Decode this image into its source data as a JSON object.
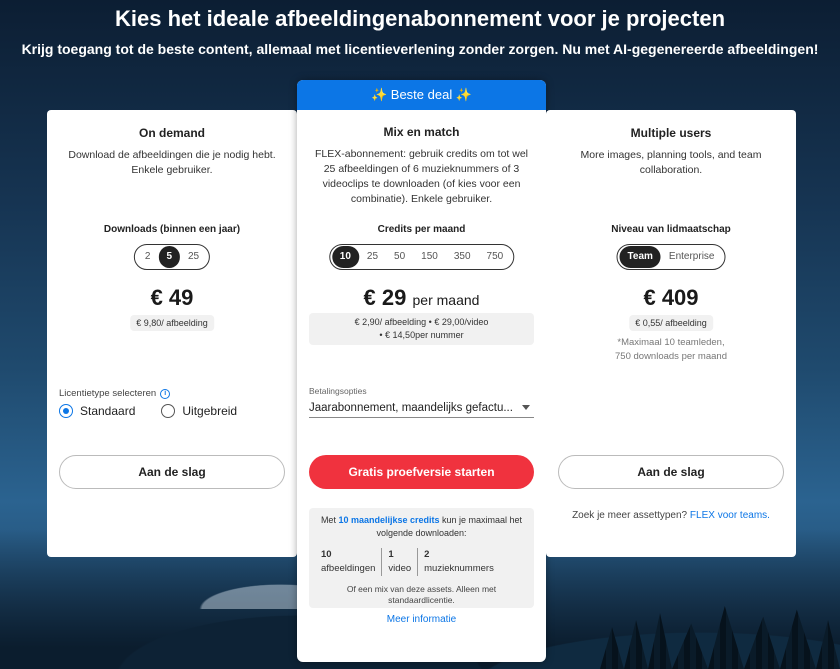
{
  "header": {
    "title": "Kies het ideale afbeeldingenabonnement voor je projecten",
    "subtitle": "Krijg toegang tot de beste content, allemaal met licentieverlening zonder zorgen. Nu met AI-gegenereerde afbeeldingen!"
  },
  "colors": {
    "accent": "#0c76e6",
    "cta": "#f0323e"
  },
  "on_demand": {
    "title": "On demand",
    "description": "Download de afbeeldingen die je nodig hebt. Enkele gebruiker.",
    "selector_label": "Downloads (binnen een jaar)",
    "options": [
      "2",
      "5",
      "25"
    ],
    "selected": "5",
    "price": "€ 49",
    "price_per_item": "€ 9,80/ afbeelding",
    "license_label": "Licentietype selecteren",
    "license_options": [
      "Standaard",
      "Uitgebreid"
    ],
    "license_selected": "Standaard",
    "cta": "Aan de slag"
  },
  "mix_match": {
    "banner": "✨ Beste deal ✨",
    "title": "Mix en match",
    "description": "FLEX-abonnement: gebruik credits om tot wel 25 afbeeldingen of 6 muzieknummers of 3 videoclips te downloaden (of kies voor een combinatie). Enkele gebruiker.",
    "selector_label": "Credits per maand",
    "options": [
      "10",
      "25",
      "50",
      "150",
      "350",
      "750"
    ],
    "selected": "10",
    "price": "€ 29",
    "price_suffix": "per maand",
    "price_line1": "€ 2,90/ afbeelding  •  € 29,00/video",
    "price_line2": "•  € 14,50per nummer",
    "billing_label": "Betalingsopties",
    "billing_value": "Jaarabonnement, maandelijks gefactu...",
    "cta": "Gratis proefversie starten",
    "info_prefix": "Met ",
    "info_highlight": "10 maandelijkse credits",
    "info_suffix": " kun je maximaal het volgende downloaden:",
    "counts": [
      {
        "num": "10",
        "label": "afbeeldingen"
      },
      {
        "num": "1",
        "label": "video"
      },
      {
        "num": "2",
        "label": "muzieknummers"
      }
    ],
    "info_footer": "Of een mix van deze assets. Alleen met standaardlicentie.",
    "more_link": "Meer informatie"
  },
  "multiple_users": {
    "title": "Multiple users",
    "description": "More images, planning tools, and team collaboration.",
    "selector_label": "Niveau van lidmaatschap",
    "options": [
      "Team",
      "Enterprise"
    ],
    "selected": "Team",
    "price": "€ 409",
    "price_per_item": "€ 0,55/ afbeelding",
    "note_line1": "*Maximaal 10 teamleden,",
    "note_line2": "750 downloads per maand",
    "cta": "Aan de slag",
    "footer_text": "Zoek je meer assettypen? ",
    "footer_link": "FLEX voor teams."
  }
}
